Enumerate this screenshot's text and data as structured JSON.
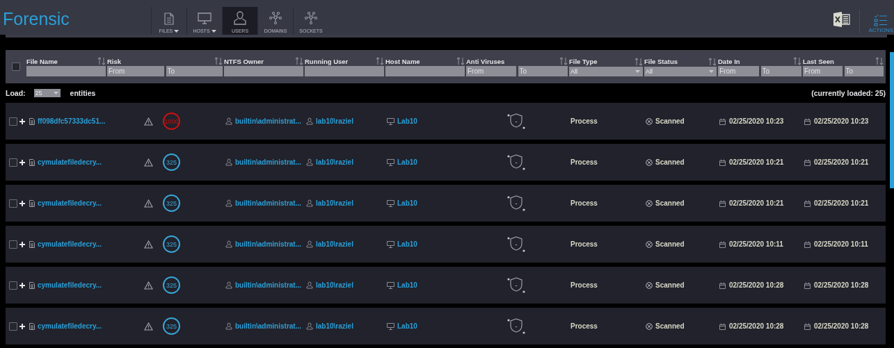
{
  "app_title": "Forensic",
  "nav_tabs": [
    {
      "label": "FILES",
      "has_menu": true,
      "selected": false
    },
    {
      "label": "HOSTS",
      "has_menu": true,
      "selected": false
    },
    {
      "label": "USERS",
      "has_menu": false,
      "selected": true
    },
    {
      "label": "DOMAINS",
      "has_menu": false,
      "selected": false
    },
    {
      "label": "SOCKETS",
      "has_menu": false,
      "selected": false
    }
  ],
  "actions_label": "ACTIONS",
  "table": {
    "select_all_checked": false,
    "columns": [
      {
        "label": "File Name",
        "kind": "text"
      },
      {
        "label": "Risk",
        "kind": "range",
        "placeholders": [
          "From",
          "To"
        ]
      },
      {
        "label": "NTFS Owner",
        "kind": "text"
      },
      {
        "label": "Running User",
        "kind": "text"
      },
      {
        "label": "Host Name",
        "kind": "text"
      },
      {
        "label": "Anti Viruses",
        "kind": "range",
        "placeholders": [
          "From",
          "To"
        ]
      },
      {
        "label": "File Type",
        "kind": "select",
        "value": "All"
      },
      {
        "label": "File Status",
        "kind": "select",
        "value": "All"
      },
      {
        "label": "Date In",
        "kind": "range",
        "placeholders": [
          "From",
          "To"
        ]
      },
      {
        "label": "Last Seen",
        "kind": "range",
        "placeholders": [
          "From",
          "To"
        ]
      }
    ],
    "load_label": "Load:",
    "load_value": "25",
    "load_suffix": "entities",
    "loaded_count": "(currently loaded: 25)",
    "rows": [
      {
        "checked": false,
        "file_name": "ff098dfc57333dc51...",
        "risk": {
          "value": "1000",
          "color": "#cc1111"
        },
        "ntfs_owner": "builtin\\administrat...",
        "running_user": "lab10\\raziel",
        "host_name": "Lab10",
        "anti_viruses": "-",
        "file_type": "Process",
        "file_status": "Scanned",
        "date_in": "02/25/2020 10:23",
        "last_seen": "02/25/2020 10:23"
      },
      {
        "checked": false,
        "file_name": "cymulatefiledecry...",
        "risk": {
          "value": "325",
          "color": "#3aa6d8"
        },
        "ntfs_owner": "builtin\\administrat...",
        "running_user": "lab10\\raziel",
        "host_name": "Lab10",
        "anti_viruses": "-",
        "file_type": "Process",
        "file_status": "Scanned",
        "date_in": "02/25/2020 10:21",
        "last_seen": "02/25/2020 10:21"
      },
      {
        "checked": false,
        "file_name": "cymulatefiledecry...",
        "risk": {
          "value": "325",
          "color": "#3aa6d8"
        },
        "ntfs_owner": "builtin\\administrat...",
        "running_user": "lab10\\raziel",
        "host_name": "Lab10",
        "anti_viruses": "-",
        "file_type": "Process",
        "file_status": "Scanned",
        "date_in": "02/25/2020 10:21",
        "last_seen": "02/25/2020 10:21"
      },
      {
        "checked": false,
        "file_name": "cymulatefiledecry...",
        "risk": {
          "value": "325",
          "color": "#3aa6d8"
        },
        "ntfs_owner": "builtin\\administrat...",
        "running_user": "lab10\\raziel",
        "host_name": "Lab10",
        "anti_viruses": "-",
        "file_type": "Process",
        "file_status": "Scanned",
        "date_in": "02/25/2020 10:11",
        "last_seen": "02/25/2020 10:11"
      },
      {
        "checked": false,
        "file_name": "cymulatefiledecry...",
        "risk": {
          "value": "325",
          "color": "#3aa6d8"
        },
        "ntfs_owner": "builtin\\administrat...",
        "running_user": "lab10\\raziel",
        "host_name": "Lab10",
        "anti_viruses": "-",
        "file_type": "Process",
        "file_status": "Scanned",
        "date_in": "02/25/2020 10:28",
        "last_seen": "02/25/2020 10:28"
      },
      {
        "checked": false,
        "file_name": "cymulatefiledecry...",
        "risk": {
          "value": "325",
          "color": "#3aa6d8"
        },
        "ntfs_owner": "builtin\\administrat...",
        "running_user": "lab10\\raziel",
        "host_name": "Lab10",
        "anti_viruses": "-",
        "file_type": "Process",
        "file_status": "Scanned",
        "date_in": "02/25/2020 10:28",
        "last_seen": "02/25/2020 10:28"
      }
    ]
  }
}
